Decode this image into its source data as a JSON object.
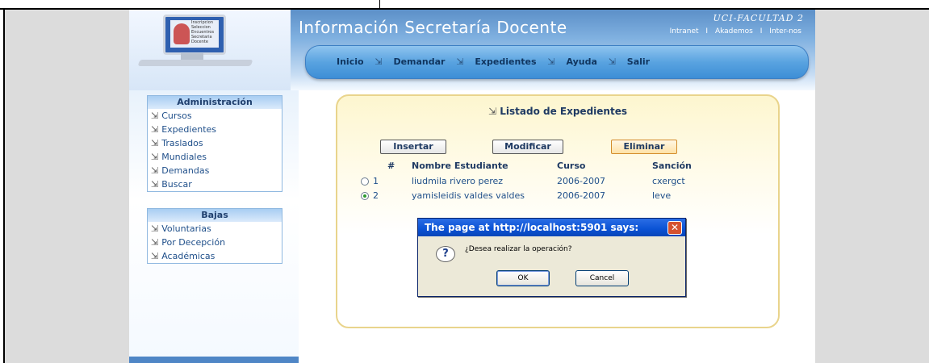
{
  "top_banner": {
    "text": ""
  },
  "header": {
    "logo_screen_text": "Inscripcion\nSeleccion\nEncuentros\nSecretaria\nDocente",
    "site_title": "Información Secretaría Docente",
    "faculty": "UCI-FACULTAD 2",
    "links": [
      "Intranet",
      "Akademos",
      "Inter-nos"
    ],
    "separator": "I"
  },
  "nav": {
    "items": [
      "Inicio",
      "Demandar",
      "Expedientes",
      "Ayuda",
      "Salir"
    ],
    "icon": "document-arrow-icon"
  },
  "sidebar": {
    "admin": {
      "title": "Administración",
      "items": [
        "Cursos",
        "Expedientes",
        "Traslados",
        "Mundiales",
        "Demandas",
        "Buscar"
      ]
    },
    "bajas": {
      "title": "Bajas",
      "items": [
        "Voluntarias",
        "Por Decepción",
        "Académicas"
      ]
    }
  },
  "content": {
    "title": "Listado de Expedientes",
    "buttons": {
      "insert": "Insertar",
      "modify": "Modificar",
      "delete": "Eliminar"
    },
    "columns": [
      "#",
      "Nombre Estudiante",
      "Curso",
      "Sanción"
    ],
    "rows": [
      {
        "num": "1",
        "name": "liudmila rivero perez",
        "course": "2006-2007",
        "sanction": "cxergct",
        "selected": false
      },
      {
        "num": "2",
        "name": "yamisleidis valdes valdes",
        "course": "2006-2007",
        "sanction": "leve",
        "selected": true
      }
    ]
  },
  "dialog": {
    "title": "The page at http://localhost:5901 says:",
    "message": "¿Desea realizar la operación?",
    "ok": "OK",
    "cancel": "Cancel",
    "close_glyph": "✕",
    "icon_glyph": "?"
  },
  "colors": {
    "header_blue": "#5c90c8",
    "nav_blue": "#59a3e0",
    "card_border": "#e9d48c",
    "dialog_title": "#0a52d4"
  }
}
